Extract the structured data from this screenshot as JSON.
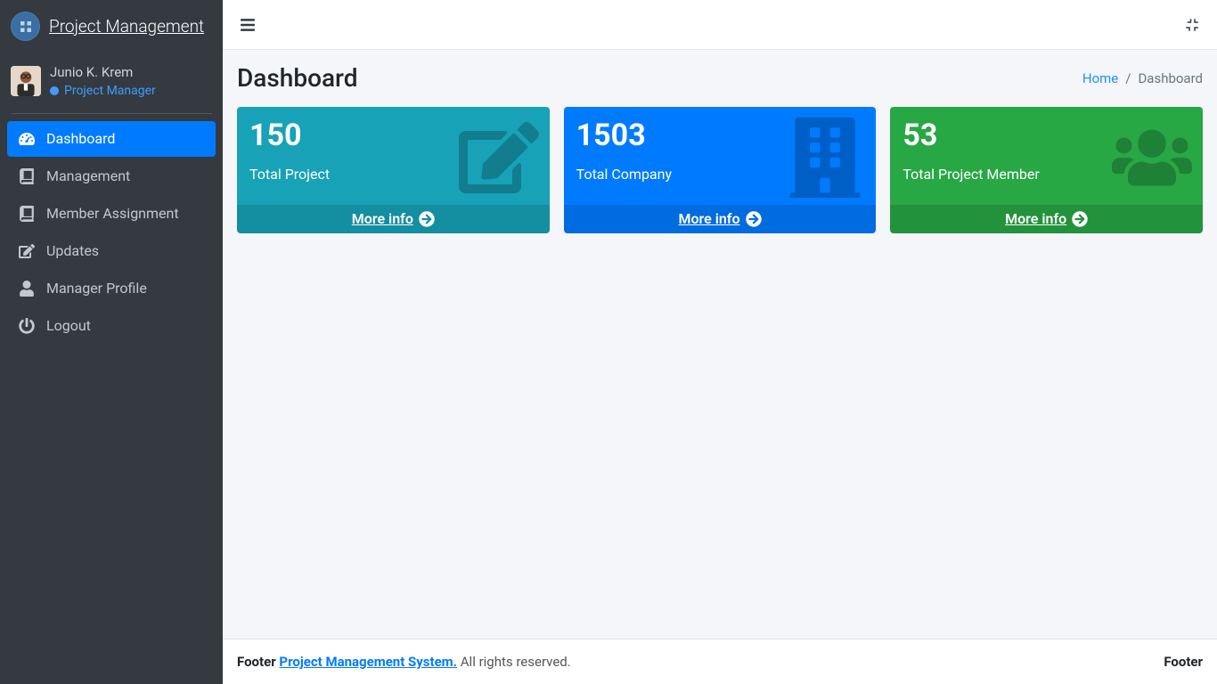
{
  "brand": {
    "title": "Project Management"
  },
  "user": {
    "name": "Junio K. Krem",
    "role": "Project Manager"
  },
  "sidebar": {
    "items": [
      "Dashboard",
      "Management",
      "Member Assignment",
      "Updates",
      "Manager Profile",
      "Logout"
    ]
  },
  "header": {
    "title": "Dashboard",
    "breadcrumb_home": "Home",
    "breadcrumb_current": "Dashboard"
  },
  "cards": {
    "more_info": "More info",
    "items": [
      {
        "value": "150",
        "label": "Total Project"
      },
      {
        "value": "1503",
        "label": "Total Company"
      },
      {
        "value": "53",
        "label": "Total Project Member"
      }
    ]
  },
  "footer": {
    "prefix": "Footer",
    "brand": "Project Management System.",
    "suffix": "All rights reserved.",
    "right": "Footer"
  }
}
